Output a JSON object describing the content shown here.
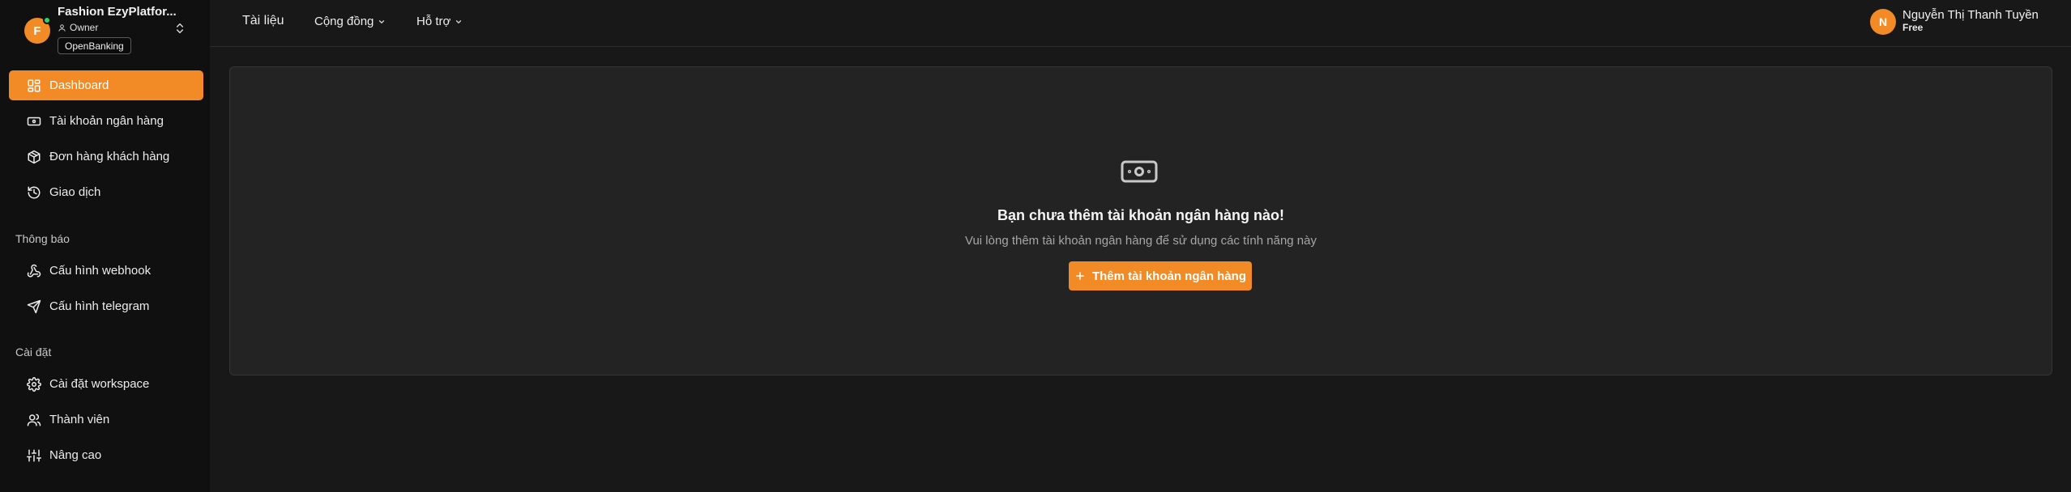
{
  "workspace": {
    "avatar_letter": "F",
    "name": "Fashion EzyPlatfor...",
    "role": "Owner",
    "badge": "OpenBanking"
  },
  "sidebar": {
    "items": [
      {
        "label": "Dashboard",
        "icon": "dashboard-icon",
        "active": true
      },
      {
        "label": "Tài khoản ngân hàng",
        "icon": "banknote-icon"
      },
      {
        "label": "Đơn hàng khách hàng",
        "icon": "package-icon"
      },
      {
        "label": "Giao dịch",
        "icon": "history-icon"
      }
    ],
    "section_notifications": "Thông báo",
    "notification_items": [
      {
        "label": "Cấu hình webhook",
        "icon": "webhook-icon"
      },
      {
        "label": "Cấu hình telegram",
        "icon": "send-icon"
      }
    ],
    "section_settings": "Cài đặt",
    "settings_items": [
      {
        "label": "Cài đặt workspace",
        "icon": "gear-icon"
      },
      {
        "label": "Thành viên",
        "icon": "users-icon"
      },
      {
        "label": "Nâng cao",
        "icon": "sliders-icon"
      }
    ]
  },
  "topbar": {
    "links": [
      {
        "label": "Tài liệu"
      },
      {
        "label": "Cộng đồng"
      },
      {
        "label": "Hỗ trợ"
      }
    ],
    "user": {
      "avatar_letter": "N",
      "name": "Nguyễn Thị Thanh Tuyền",
      "plan": "Free"
    }
  },
  "empty_state": {
    "icon": "banknote-icon",
    "title": "Bạn chưa thêm tài khoản ngân hàng nào!",
    "subtitle": "Vui lòng thêm tài khoản ngân hàng để sử dụng các tính năng này",
    "button_label": "Thêm tài khoản ngân hàng"
  },
  "colors": {
    "accent": "#f28a26",
    "sidebar_bg": "#101010",
    "main_bg": "#181818",
    "card_bg": "#232323"
  }
}
